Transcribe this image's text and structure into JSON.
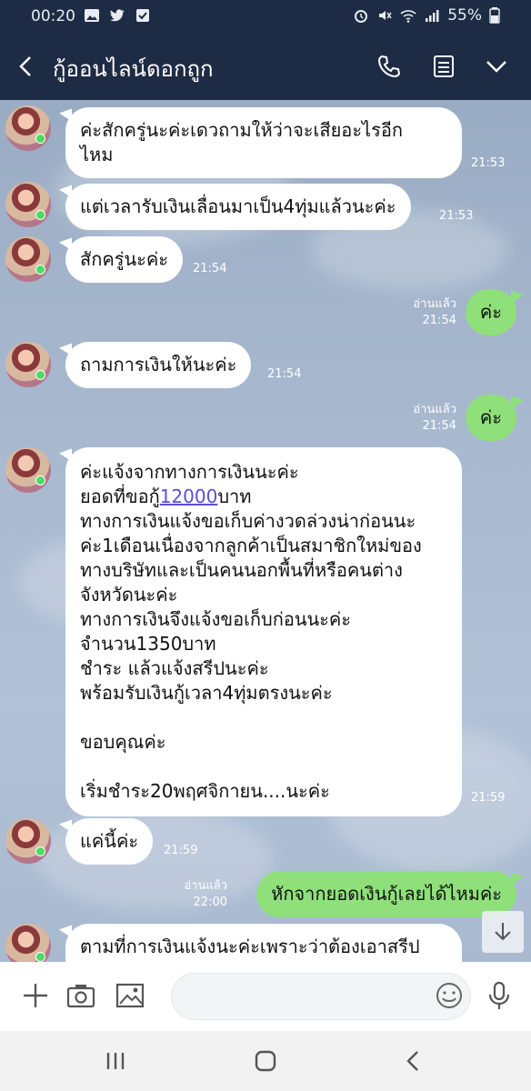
{
  "status_bar": {
    "time": "00:20",
    "left_icons": [
      "image-icon",
      "twitter-icon",
      "check-square-icon"
    ],
    "right_icons": [
      "alarm-icon",
      "mute-icon",
      "wifi-icon",
      "signal-icon"
    ],
    "battery": "55%"
  },
  "header": {
    "title": "กู้ออนไลน์ดอกถูก",
    "actions": [
      "phone-icon",
      "notes-icon",
      "chevron-down-icon"
    ]
  },
  "messages": [
    {
      "side": "in",
      "lines": [
        "ค่ะสักครู่นะค่ะเดวถามให้ว่าจะเสียอะไรอีก",
        "ไหม"
      ],
      "time": "21:53"
    },
    {
      "side": "in",
      "lines": [
        "แต่เวลารับเงินเลื่อนมาเป็น4ทุ่มแล้วนะค่ะ"
      ],
      "time": "21:53"
    },
    {
      "side": "in",
      "lines": [
        "สักครู่นะค่ะ"
      ],
      "time": "21:54"
    },
    {
      "side": "out",
      "lines": [
        "ค่ะ"
      ],
      "read": "อ่านแล้ว",
      "time": "21:54"
    },
    {
      "side": "in",
      "lines": [
        "ถามการเงินให้นะค่ะ"
      ],
      "time": "21:54"
    },
    {
      "side": "out",
      "lines": [
        "ค่ะ"
      ],
      "read": "อ่านแล้ว",
      "time": "21:54"
    },
    {
      "side": "in",
      "lines": [
        "ค่ะแจ้งจากทางการเงินนะค่ะ",
        "ยอดที่ขอกู้",
        "ทางการเงินแจ้งขอเก็บค่างวดล่วงน่าก่อนนะ",
        "ค่ะ1เดือนเนื่องจากลูกค้าเป็นสมาชิกใหม่ของ",
        "ทางบริษัทและเป็นคนนอกพื้นที่หรือคนต่าง",
        "จังหวัดนะค่ะ",
        "ทางการเงินจึงแจ้งขอเก็บก่อนนะค่ะ",
        "จำนวน1350บาท",
        "ชำระ แล้วแจ้งสรีปนะค่ะ",
        "พร้อมรับเงินกู้เวลา4ทุ่มตรงนะค่ะ",
        "",
        "ขอบคุณค่ะ",
        "",
        "เริ่มชำระ20พฤศจิกายน....นะค่ะ"
      ],
      "amount_link": "12000",
      "amount_suffix": "บาท",
      "time": "21:59"
    },
    {
      "side": "in",
      "lines": [
        "แค่นี้ค่ะ"
      ],
      "time": "21:59"
    },
    {
      "side": "out",
      "lines": [
        "หักจากยอดเงินกู้เลยได้ไหมค่ะ"
      ],
      "read": "อ่านแล้ว",
      "time": "22:00"
    },
    {
      "side": "in",
      "lines": [
        "ตามที่การเงินแจ้งนะค่ะเพราะว่าต้องเอาสรีป"
      ],
      "time": ""
    }
  ],
  "input_bar": {
    "icons": [
      "plus-icon",
      "camera-icon",
      "image-icon",
      "emoji-icon",
      "mic-icon"
    ],
    "placeholder": ""
  },
  "nav_bar": {
    "icons": [
      "recent-apps-icon",
      "home-icon",
      "back-icon"
    ]
  },
  "colors": {
    "header_bg": "#1e2b44",
    "chat_bg": "#a7b8ce",
    "incoming_bubble": "#ffffff",
    "outgoing_bubble": "#8fe07a",
    "link": "#5b4fd6"
  }
}
